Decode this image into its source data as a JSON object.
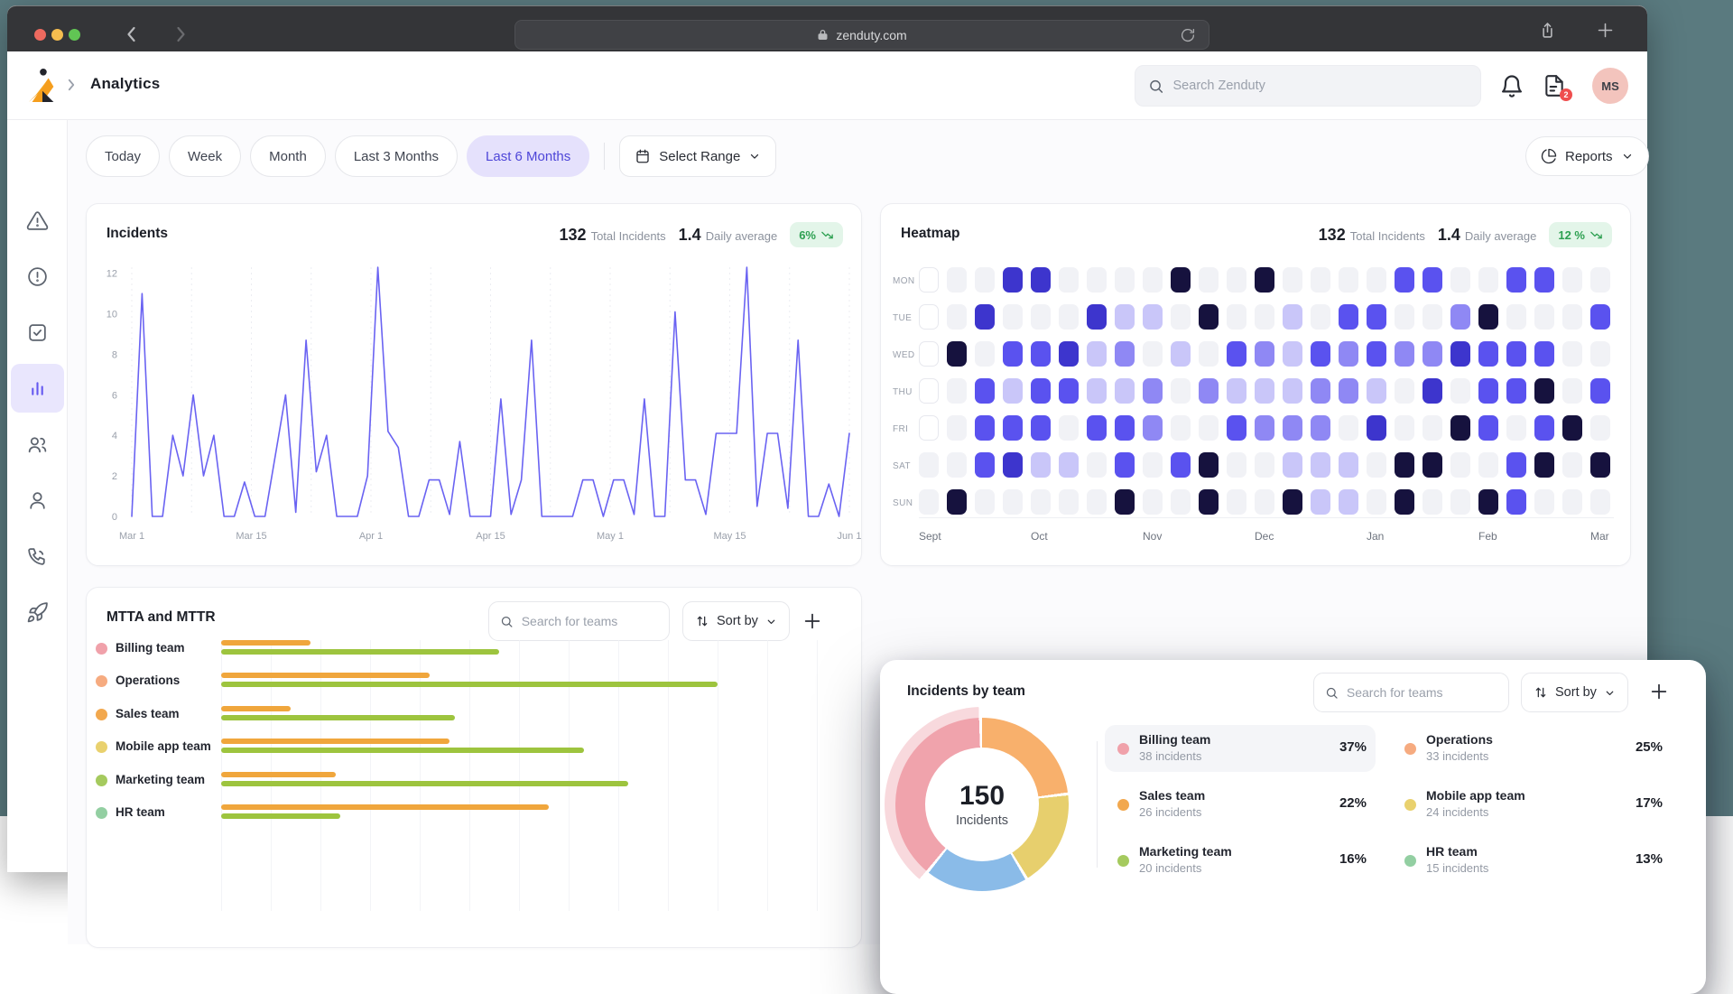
{
  "browser": {
    "url": "zenduty.com"
  },
  "nav": {
    "title": "Analytics",
    "search_placeholder": "Search Zenduty",
    "notification_badge": "2",
    "avatar_initials": "MS"
  },
  "filters": {
    "chips": [
      "Today",
      "Week",
      "Month",
      "Last 3 Months",
      "Last 6 Months"
    ],
    "active_index": 4,
    "select_range": "Select Range",
    "reports": "Reports"
  },
  "sidebar": {
    "items": [
      "incidents",
      "alerts",
      "tasks",
      "analytics",
      "teams",
      "profile",
      "on-call",
      "integrations"
    ],
    "active_index": 3
  },
  "incidents_card": {
    "title": "Incidents",
    "total_value": "132",
    "total_label": "Total Incidents",
    "avg_value": "1.4",
    "avg_label": "Daily average",
    "trend": "6%"
  },
  "heatmap_card": {
    "title": "Heatmap",
    "total_value": "132",
    "total_label": "Total Incidents",
    "avg_value": "1.4",
    "avg_label": "Daily average",
    "trend": "12 %"
  },
  "mtta_card": {
    "title": "MTTA and MTTR",
    "search_placeholder": "Search for teams",
    "sort_label": "Sort by"
  },
  "team_card": {
    "title": "Incidents by team",
    "search_placeholder": "Search for teams",
    "sort_label": "Sort by",
    "center_value": "150",
    "center_label": "Incidents",
    "legend_left": [
      {
        "name": "Billing team",
        "count": "38 incidents",
        "pct": "37%",
        "color": "#f0a1aa",
        "highlighted": true
      },
      {
        "name": "Sales team",
        "count": "26 incidents",
        "pct": "22%",
        "color": "#f2a84e",
        "highlighted": false
      },
      {
        "name": "Marketing team",
        "count": "20 incidents",
        "pct": "16%",
        "color": "#a5ca5e",
        "highlighted": false
      }
    ],
    "legend_right": [
      {
        "name": "Operations",
        "count": "33 incidents",
        "pct": "25%",
        "color": "#f6ab80",
        "highlighted": false
      },
      {
        "name": "Mobile app team",
        "count": "24 incidents",
        "pct": "17%",
        "color": "#e9d16e",
        "highlighted": false
      },
      {
        "name": "HR team",
        "count": "15 incidents",
        "pct": "13%",
        "color": "#93cfa2",
        "highlighted": false
      }
    ]
  },
  "chart_data": [
    {
      "id": "incidents_line",
      "type": "line",
      "title": "Incidents",
      "x_ticks": [
        "Mar 1",
        "Mar 15",
        "Apr 1",
        "Apr 15",
        "May 1",
        "May 15",
        "Jun 1"
      ],
      "y_ticks": [
        0,
        2,
        4,
        6,
        8,
        10,
        12
      ],
      "ylim": [
        0,
        12.3
      ],
      "color": "#6a63f2",
      "grid": "vertical-dashed",
      "values": [
        0,
        11,
        0,
        0,
        4,
        2,
        6,
        2,
        4,
        0,
        0,
        1.7,
        0,
        0,
        3,
        6,
        0.2,
        8.7,
        2.2,
        4,
        0,
        0,
        0,
        2,
        12.3,
        4.2,
        3.4,
        0,
        0,
        1.8,
        1.8,
        0.1,
        3.7,
        0,
        0,
        0,
        5.8,
        0.1,
        1.8,
        8.7,
        0,
        0,
        0,
        0,
        1.8,
        1.8,
        0,
        1.8,
        1.8,
        0.1,
        5.8,
        0,
        0,
        10.1,
        1.8,
        1.8,
        0.1,
        4.1,
        4.1,
        4.1,
        12.3,
        0.5,
        4.1,
        4.1,
        0.4,
        8.7,
        0,
        0,
        1.6,
        0,
        4.1
      ]
    },
    {
      "id": "weekly_heatmap",
      "type": "heatmap",
      "rows": [
        "MON",
        "TUE",
        "WED",
        "THU",
        "FRI",
        "SAT",
        "SUN"
      ],
      "months": [
        {
          "label": "Sept",
          "col": 0
        },
        {
          "label": "Oct",
          "col": 4
        },
        {
          "label": "Nov",
          "col": 8
        },
        {
          "label": "Dec",
          "col": 12
        },
        {
          "label": "Jan",
          "col": 16
        },
        {
          "label": "Feb",
          "col": 20
        },
        {
          "label": "Mar",
          "col": 24
        }
      ],
      "levels": {
        "W": "#ffffff",
        "0": "#f1f2f6",
        "1": "#c9c6f9",
        "2": "#8f88f4",
        "3": "#5a52ef",
        "4": "#3d35cd",
        "5": "#16123e"
      },
      "grid": [
        "W 0 0 4 4 0 0 0 0 5 0 0 5 0 0 0 0 3 3 0 0 3 3 0 0",
        "W 0 4 0 0 0 4 1 1 0 5 0 0 1 0 3 3 0 0 2 5 0 0 0 3",
        "W 5 0 3 3 4 1 2 0 1 0 3 2 1 3 2 3 2 2 4 3 3 3 0 0",
        "W 0 3 1 3 3 1 1 2 0 2 1 1 1 2 2 1 0 4 0 3 3 5 0 3",
        "W 0 3 3 3 0 3 3 2 0 0 3 2 2 2 0 4 0 0 5 3 0 3 5 0",
        "0 0 3 4 1 1 0 3 0 3 5 0 0 1 1 1 0 5 5 0 0 3 5 0 5",
        "0 5 0 0 0 0 0 5 0 0 5 0 0 5 1 1 0 5 0 0 5 3 0 0 0"
      ]
    },
    {
      "id": "mtta_mttr_bars",
      "type": "bar",
      "orientation": "horizontal",
      "series": [
        "MTTA",
        "MTTR"
      ],
      "colors": [
        "#f0a63c",
        "#9dc43e"
      ],
      "xlim": [
        0,
        100
      ],
      "teams": [
        {
          "name": "Billing team",
          "dot": "#f0a1aa",
          "mtta": 18,
          "mttr": 56
        },
        {
          "name": "Operations",
          "dot": "#f6ab80",
          "mtta": 42,
          "mttr": 100
        },
        {
          "name": "Sales team",
          "dot": "#f2a84e",
          "mtta": 14,
          "mttr": 47
        },
        {
          "name": "Mobile app team",
          "dot": "#e9d16e",
          "mtta": 46,
          "mttr": 73
        },
        {
          "name": "Marketing team",
          "dot": "#a5ca5e",
          "mtta": 23,
          "mttr": 82
        },
        {
          "name": "HR team",
          "dot": "#93cfa2",
          "mtta": 66,
          "mttr": 24
        }
      ]
    },
    {
      "id": "incidents_by_team_donut",
      "type": "pie",
      "total": 150,
      "center_label": "Incidents",
      "teams": [
        {
          "name": "Billing team",
          "incidents": 38,
          "pct": 37
        },
        {
          "name": "Operations",
          "incidents": 33,
          "pct": 25
        },
        {
          "name": "Sales team",
          "incidents": 26,
          "pct": 22
        },
        {
          "name": "Mobile app team",
          "incidents": 24,
          "pct": 17
        },
        {
          "name": "Marketing team",
          "incidents": 20,
          "pct": 16
        },
        {
          "name": "HR team",
          "incidents": 15,
          "pct": 13
        }
      ],
      "segments": [
        {
          "name": "Operations",
          "color": "#f8b06c",
          "start": 0,
          "end": 82
        },
        {
          "name": "Mobile app team",
          "color": "#e7cf6d",
          "start": 84,
          "end": 148
        },
        {
          "name": "HR team",
          "color": "#8abbe8",
          "start": 150,
          "end": 218
        },
        {
          "name": "Billing team",
          "color": "#f0a3ac",
          "start": 220,
          "end": 358,
          "highlight": "#f8d9dd"
        }
      ]
    }
  ]
}
